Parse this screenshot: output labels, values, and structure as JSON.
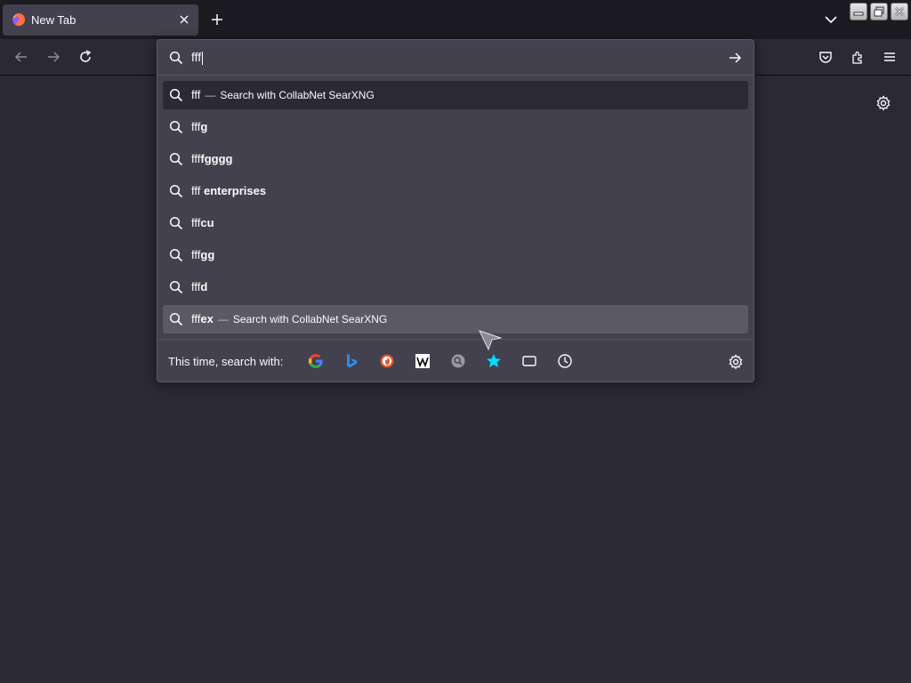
{
  "tab": {
    "title": "New Tab"
  },
  "urlbar": {
    "value": "fff"
  },
  "results": [
    {
      "prefix": "fff",
      "bold": "",
      "separator": "—",
      "action": "Search with CollabNet SearXNG",
      "type": "heuristic"
    },
    {
      "prefix": "fff",
      "bold": "g",
      "separator": "",
      "action": "",
      "type": "normal"
    },
    {
      "prefix": "fff",
      "bold": "fgggg",
      "separator": "",
      "action": "",
      "type": "normal"
    },
    {
      "prefix": "fff ",
      "bold": "enterprises",
      "separator": "",
      "action": "",
      "type": "normal"
    },
    {
      "prefix": "fff",
      "bold": "cu",
      "separator": "",
      "action": "",
      "type": "normal"
    },
    {
      "prefix": "fff",
      "bold": "gg",
      "separator": "",
      "action": "",
      "type": "normal"
    },
    {
      "prefix": "fff",
      "bold": "d",
      "separator": "",
      "action": "",
      "type": "normal"
    },
    {
      "prefix": "fff",
      "bold": "ex",
      "separator": "—",
      "action": "Search with CollabNet SearXNG",
      "type": "hover"
    }
  ],
  "oneoff": {
    "label": "This time, search with:",
    "engines": [
      {
        "name": "google-icon"
      },
      {
        "name": "bing-icon"
      },
      {
        "name": "duckduckgo-icon"
      },
      {
        "name": "wikipedia-icon"
      },
      {
        "name": "searxng-icon"
      },
      {
        "name": "bookmarks-icon"
      },
      {
        "name": "tabs-icon"
      },
      {
        "name": "history-icon"
      }
    ]
  },
  "colors": {
    "background": "#2b2a33",
    "tabstrip": "#1c1b22",
    "panel": "#42414d",
    "highlight": "#5b5a63"
  }
}
